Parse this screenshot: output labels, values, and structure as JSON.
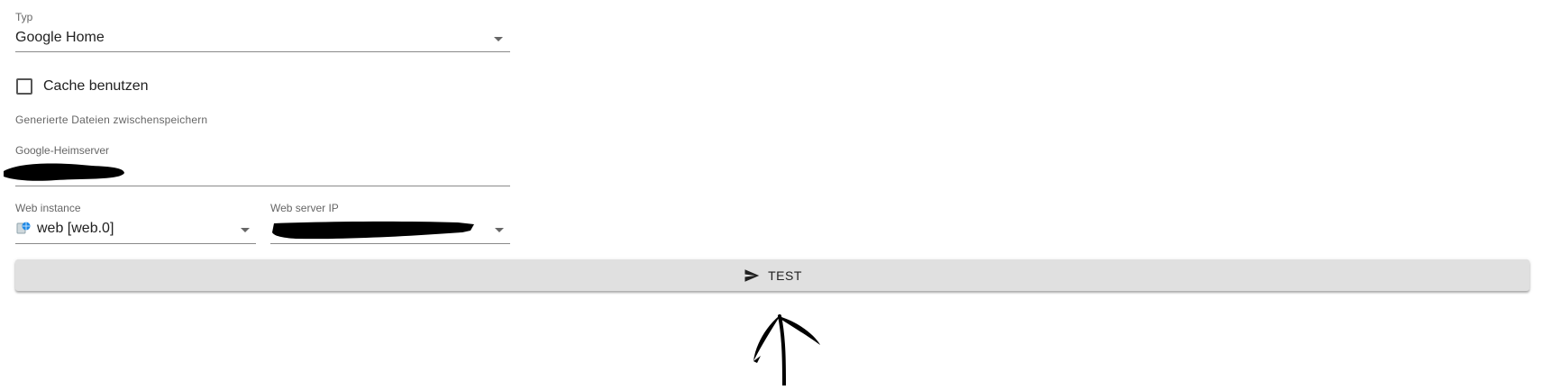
{
  "type_field": {
    "label": "Typ",
    "value": "Google Home"
  },
  "cache": {
    "label": "Cache benutzen",
    "checked": false,
    "hint": "Generierte Dateien zwischenspeichern"
  },
  "server_field": {
    "label": "Google-Heimserver",
    "value": ""
  },
  "web_instance": {
    "label": "Web instance",
    "value": "web [web.0]",
    "icon": "web-adapter-icon"
  },
  "web_server_ip": {
    "label": "Web server IP",
    "value": ""
  },
  "test_button": {
    "label": "TEST",
    "icon": "send-icon"
  }
}
